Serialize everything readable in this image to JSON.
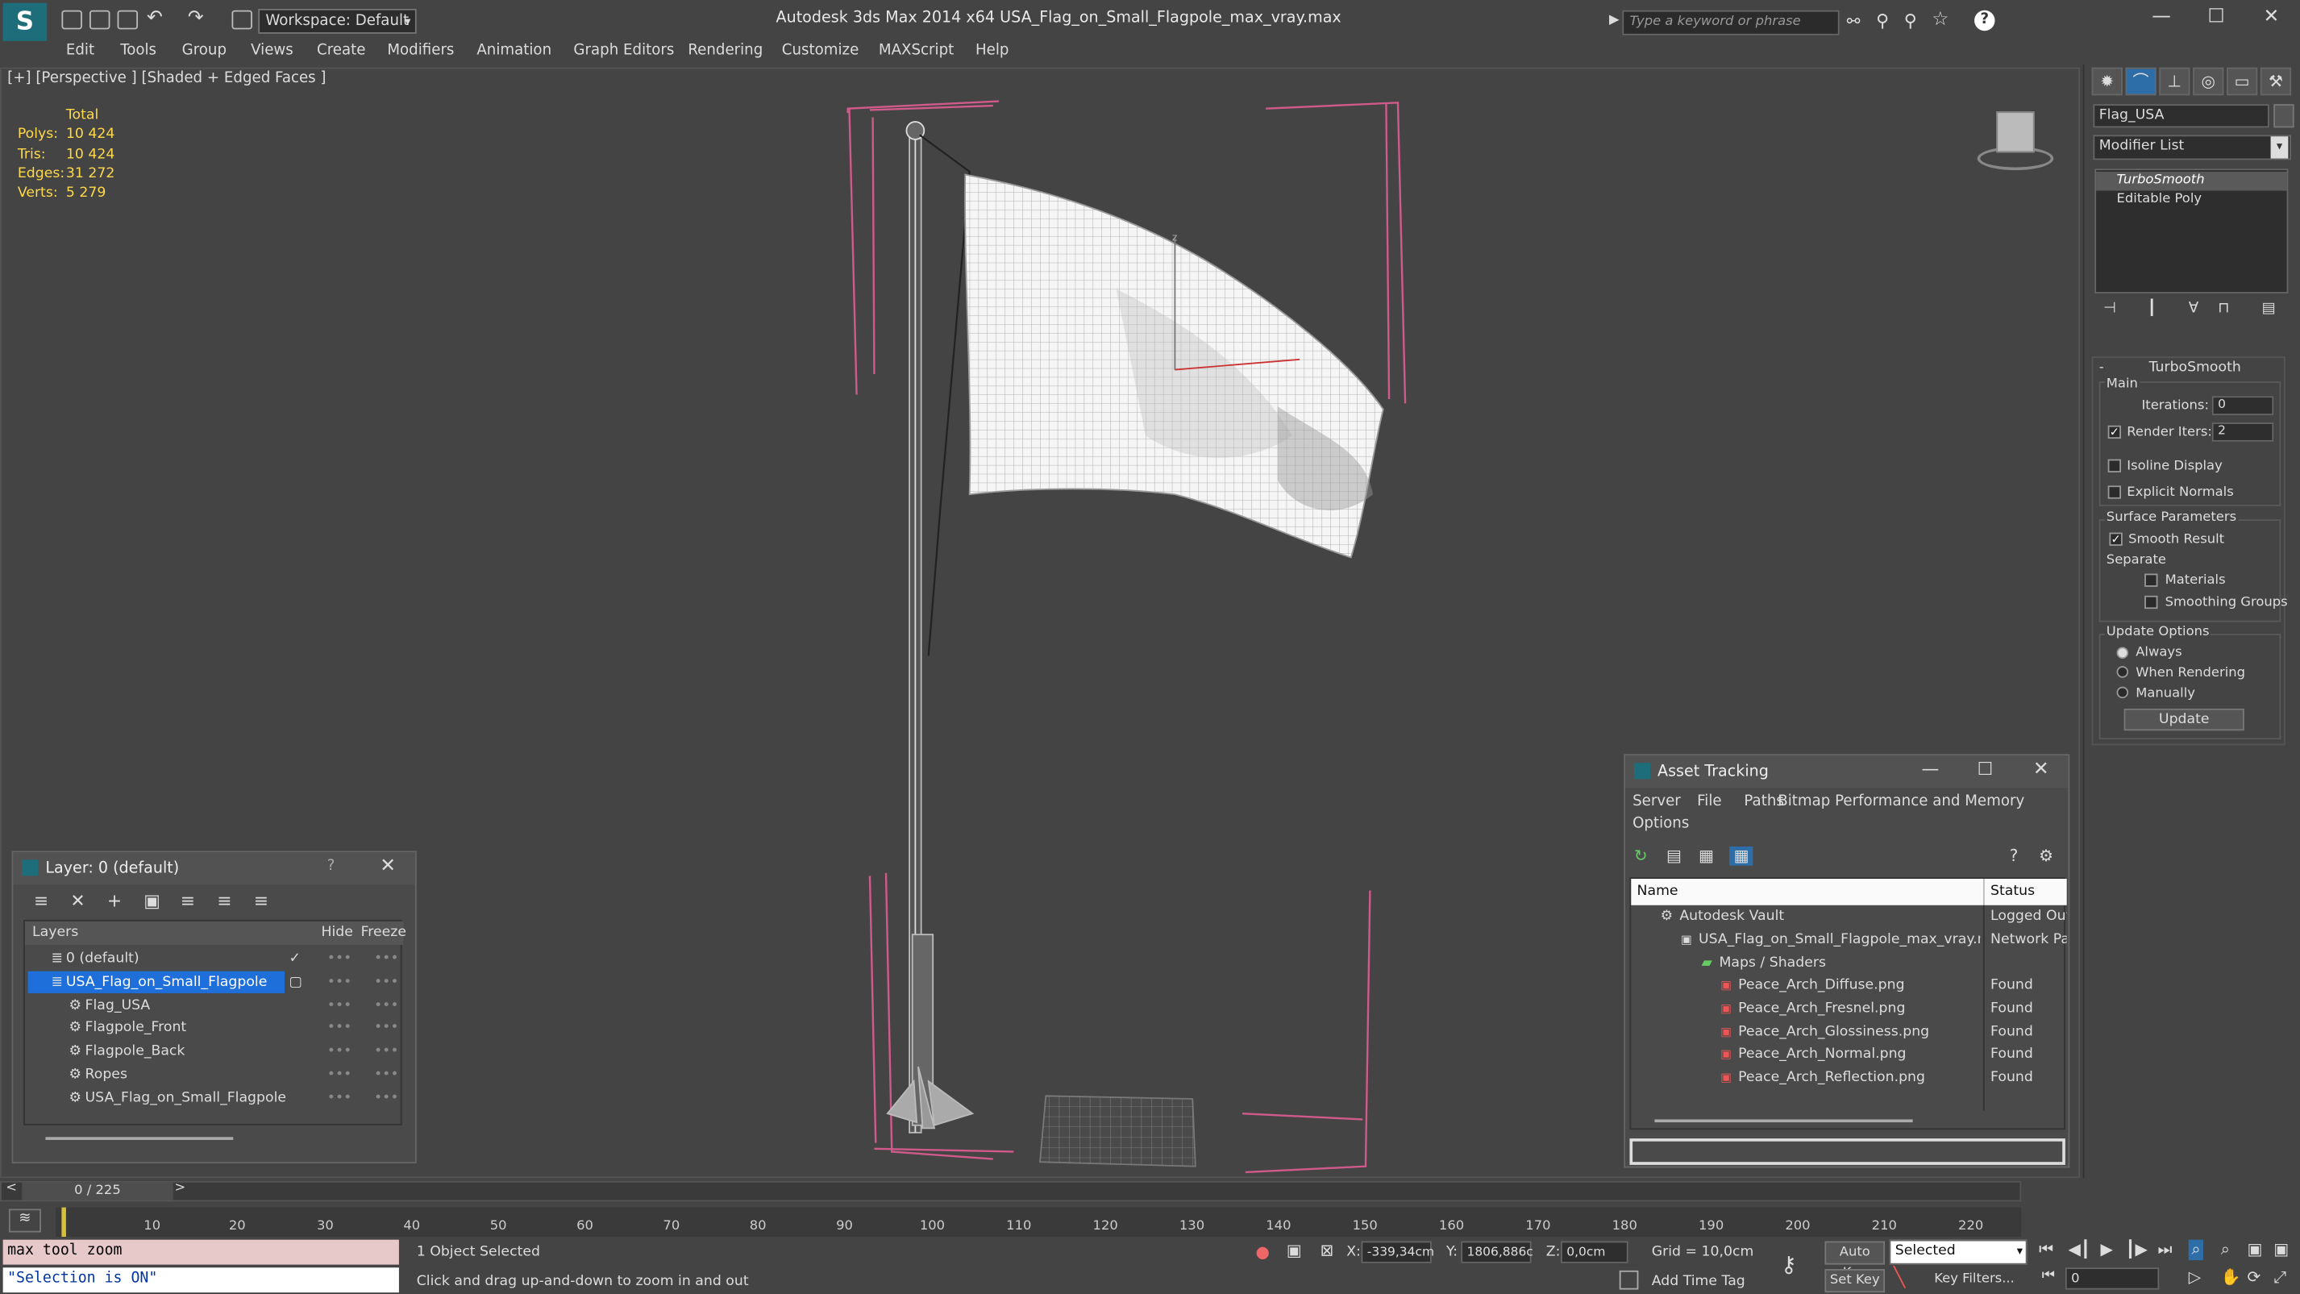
{
  "app": {
    "title": "Autodesk 3ds Max  2014 x64     USA_Flag_on_Small_Flagpole_max_vray.max",
    "workspace": "Workspace: Default",
    "search_placeholder": "Type a keyword or phrase"
  },
  "menu": [
    "Edit",
    "Tools",
    "Group",
    "Views",
    "Create",
    "Modifiers",
    "Animation",
    "Graph Editors",
    "Rendering",
    "Customize",
    "MAXScript",
    "Help"
  ],
  "viewport": {
    "label": "[+] [Perspective ] [Shaded + Edged Faces ]",
    "stats_header": "Total",
    "stats": [
      {
        "k": "Polys:",
        "v": "10 424"
      },
      {
        "k": "Tris:",
        "v": "10 424"
      },
      {
        "k": "Edges:",
        "v": "31 272"
      },
      {
        "k": "Verts:",
        "v": "5 279"
      }
    ]
  },
  "command_panel": {
    "object_name": "Flag_USA",
    "modifier_list": "Modifier List",
    "stack": [
      "TurboSmooth",
      "Editable Poly"
    ],
    "rollout_title": "TurboSmooth",
    "main_label": "Main",
    "iterations_label": "Iterations:",
    "iterations_value": "0",
    "render_iters_label": "Render Iters:",
    "render_iters_value": "2",
    "isoline": "Isoline Display",
    "explicit": "Explicit Normals",
    "surface_params": "Surface Parameters",
    "smooth_result": "Smooth Result",
    "separate": "Separate",
    "materials": "Materials",
    "smoothing_groups": "Smoothing Groups",
    "update_options": "Update Options",
    "always": "Always",
    "when_rendering": "When Rendering",
    "manually": "Manually",
    "update_btn": "Update"
  },
  "layer_panel": {
    "title": "Layer: 0 (default)",
    "help": "?",
    "col_layers": "Layers",
    "col_hide": "Hide",
    "col_freeze": "Freeze",
    "rows": [
      "0 (default)",
      "USA_Flag_on_Small_Flagpole",
      "Flag_USA",
      "Flagpole_Front",
      "Flagpole_Back",
      "Ropes",
      "USA_Flag_on_Small_Flagpole"
    ]
  },
  "asset_panel": {
    "title": "Asset Tracking",
    "menu": [
      "Server",
      "File",
      "Paths",
      "Bitmap Performance and Memory"
    ],
    "menu2": "Options",
    "col_name": "Name",
    "col_status": "Status",
    "rows": [
      {
        "name": "Autodesk Vault",
        "status": "Logged Out"
      },
      {
        "name": "USA_Flag_on_Small_Flagpole_max_vray.max",
        "status": "Network Pa"
      },
      {
        "name": "Maps / Shaders",
        "status": ""
      },
      {
        "name": "Peace_Arch_Diffuse.png",
        "status": "Found"
      },
      {
        "name": "Peace_Arch_Fresnel.png",
        "status": "Found"
      },
      {
        "name": "Peace_Arch_Glossiness.png",
        "status": "Found"
      },
      {
        "name": "Peace_Arch_Normal.png",
        "status": "Found"
      },
      {
        "name": "Peace_Arch_Reflection.png",
        "status": "Found"
      }
    ]
  },
  "timeline": {
    "frame": "0 / 225",
    "ticks": [
      "10",
      "20",
      "30",
      "40",
      "50",
      "60",
      "70",
      "80",
      "90",
      "100",
      "110",
      "120",
      "130",
      "140",
      "150",
      "160",
      "170",
      "180",
      "190",
      "200",
      "210",
      "220"
    ]
  },
  "status": {
    "listener_1": "max tool zoom",
    "listener_2": "\"Selection is ON\"",
    "selected": "1 Object Selected",
    "prompt": "Click and drag up-and-down to zoom in and out",
    "x_label": "X:",
    "x_value": "-339,34cm",
    "y_label": "Y:",
    "y_value": "1806,886c",
    "z_label": "Z:",
    "z_value": "0,0cm",
    "grid": "Grid = 10,0cm",
    "add_time_tag": "Add Time Tag",
    "auto_key": "Auto Key",
    "set_key": "Set Key",
    "selected_dropdown": "Selected",
    "key_filters": "Key Filters...",
    "frame_field": "0"
  },
  "colors": {
    "selection": "#1e6fd9",
    "accent_yellow": "#ffd94a",
    "found": "#ddd"
  }
}
